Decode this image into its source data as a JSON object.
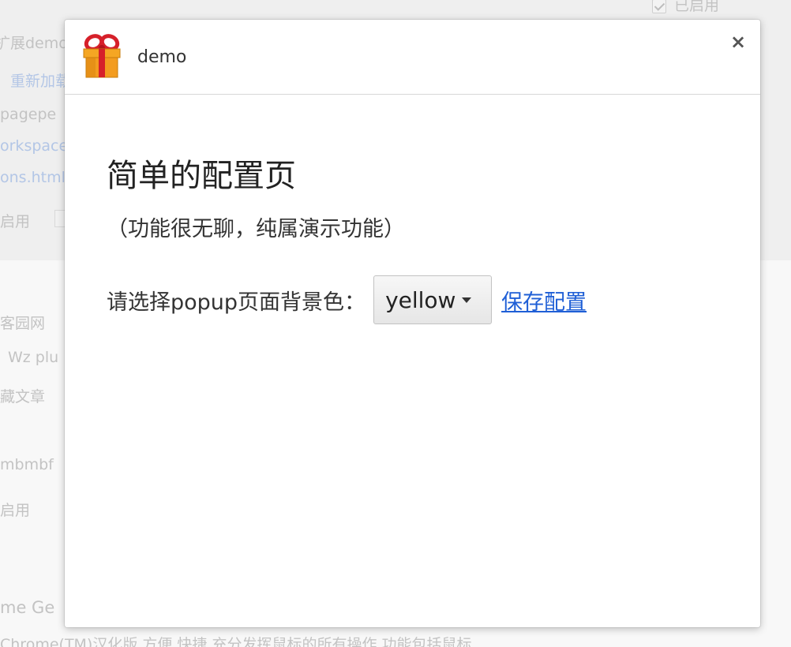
{
  "background": {
    "top_enabled": "已启用",
    "lines": [
      "扩展demo",
      "重新加载",
      "pagepe",
      "orkspace",
      "ons.html",
      "启用",
      "客园网",
      "Wz plu",
      "藏文章",
      "mbmbf",
      "启用",
      "me Ge",
      "Chrome(TM)汉化版 方便 快捷 充分发挥鼠标的所有操作 功能包括鼠标"
    ]
  },
  "dialog": {
    "extension_name": "demo",
    "close_symbol": "×",
    "icon": "gift-icon",
    "title": "简单的配置页",
    "subtitle": "（功能很无聊，纯属演示功能）",
    "select_label": "请选择popup页面背景色：",
    "select_value": "yellow",
    "save_label": "保存配置"
  },
  "colors": {
    "link": "#1f5fd6",
    "divider": "#d8d8d8",
    "text": "#333333"
  }
}
